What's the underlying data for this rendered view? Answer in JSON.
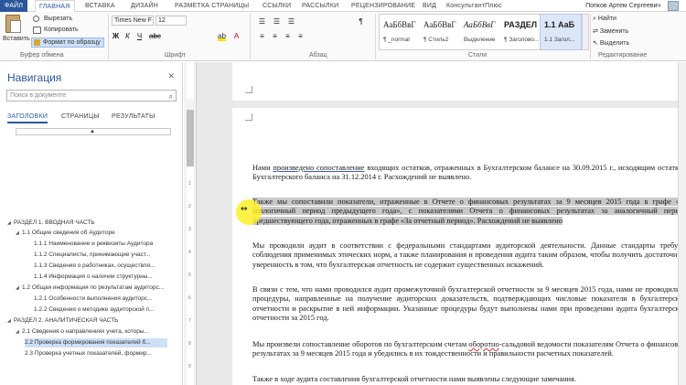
{
  "tabs": {
    "file": "ФАЙЛ",
    "items": [
      "ГЛАВНАЯ",
      "ВСТАВКА",
      "ДИЗАЙН",
      "РАЗМЕТКА СТРАНИЦЫ",
      "ССЫЛКИ",
      "РАССЫЛКИ",
      "РЕЦЕНЗИРОВАНИЕ",
      "ВИД",
      "КонсультантПлюс"
    ],
    "user": "Попков Артем Сергеевич"
  },
  "ribbon": {
    "clipboard": {
      "paste": "Вставить",
      "cut": "Вырезать",
      "copy": "Копировать",
      "format_painter": "Формат по образцу",
      "label": "Буфер обмена"
    },
    "font": {
      "name": "Times New F",
      "size": "12",
      "label": "Шрифт"
    },
    "paragraph_label": "Абзац",
    "styles": {
      "label": "Стили",
      "items": [
        {
          "sample": "АаБбВвГ",
          "name": "¶ _normal"
        },
        {
          "sample": "АаБбВвГ",
          "name": "¶ Стиль2"
        },
        {
          "sample": "АаБбВвГ",
          "name": "Выделение"
        },
        {
          "sample": "РАЗДЕЛ",
          "name": "¶ Заголово..."
        },
        {
          "sample": "1.1 АаБ",
          "name": "1.1 Загол..."
        }
      ]
    },
    "editing": {
      "find": "Найти",
      "replace": "Заменить",
      "select": "Выделить",
      "label": "Редактирование"
    }
  },
  "nav": {
    "title": "Навигация",
    "search_placeholder": "Поиск в документе",
    "tabs": [
      "ЗАГОЛОВКИ",
      "СТРАНИЦЫ",
      "РЕЗУЛЬТАТЫ"
    ],
    "items": [
      {
        "text": "РАЗДЕЛ 1. ВВОДНАЯ ЧАСТЬ",
        "level": 0
      },
      {
        "text": "1.1 Общие сведения об Аудиторе",
        "level": 1
      },
      {
        "text": "1.1.1 Наименование и реквизиты Аудитора",
        "level": 2
      },
      {
        "text": "1.1.2 Специалисты, принимающие участ...",
        "level": 2
      },
      {
        "text": "1.1.3 Сведения о работниках, осуществля...",
        "level": 2
      },
      {
        "text": "1.1.4 Информация о наличии структурны...",
        "level": 2
      },
      {
        "text": "1.2 Общая информация по результатам аудиторс...",
        "level": 1
      },
      {
        "text": "1.2.1 Особенности выполнения аудиторс...",
        "level": 2
      },
      {
        "text": "1.2.2 Сведения о методике аудиторской п...",
        "level": 2
      },
      {
        "text": "РАЗДЕЛ 2. АНАЛИТИЧЕСКАЯ ЧАСТЬ",
        "level": 0
      },
      {
        "text": "2.1 Сведения о направлениях учета, которы...",
        "level": 1
      },
      {
        "text": "2.2 Проверка формирования показателей б...",
        "level": 1
      },
      {
        "text": "2.3 Проверка учетных показателей, формир...",
        "level": 1
      }
    ]
  },
  "doc": {
    "p1_a": "Нами ",
    "p1_link": "произведено сопоставление",
    "p1_b": " входящих остатков, отраженных в Бухгалтерском балансе на 30.09.2015 г., исходящим остаткам Бухгалтерского баланса на 31.12.2014 г. Расхождений не выявлено.",
    "p2": "Также мы сопоставили показатели, отраженные в Отчете о финансовых результатах за 9 месяцев 2015 года в графе «За аналогичный период предыдущего года», с показателями Отчета о финансовых результатах за аналогичный период предшествующего года, отраженных в графе «За отчетный период». Расхождений не выявлено",
    "p3": "Мы проводили аудит в соответствии с федеральными стандартами аудиторской деятельности. Данные стандарты требуют соблюдения применимых этических норм, а также планирования и проведения аудита таким образом, чтобы получить достаточную уверенность в том, что бухгалтерская отчетность не содержит существенных искажений.",
    "p4": "В связи с тем, что нами проводился аудит промежуточной бухгалтерской отчетности за 9 месяцев 2015 года, нами не проводились процедуры, направленные на получение аудиторских доказательств, подтверждающих числовые показатели в бухгалтерской отчетности и раскрытие в ней информации. Указанные процедуры будут выполнены нами при проведении аудита бухгалтерской отчетности за 2015 год.",
    "p5_a": "Мы произвели сопоставление оборотов по бухгалтерским счетам ",
    "p5_link": "оборотно",
    "p5_b": "-сальдовой ведомости показателям Отчета о финансовых результатах за 9 месяцев 2015 года и убедились в их тождественности и правильности расчетных показателей.",
    "p6": "Также в ходе аудита составления бухгалтерской отчетности нами выявлены следующие замечания."
  },
  "colors": {
    "accent": "#2b579a",
    "selection": "#cde0f7",
    "text_highlight": "#c9c9c9",
    "cursor_halo": "#fcf028"
  }
}
